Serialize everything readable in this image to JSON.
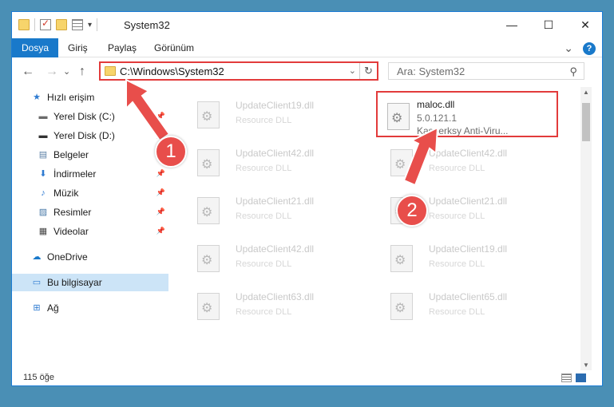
{
  "window": {
    "title": "System32",
    "controls": {
      "minimize": "—",
      "maximize": "☐",
      "close": "✕"
    }
  },
  "ribbon": {
    "tabs": [
      "Dosya",
      "Giriş",
      "Paylaş",
      "Görünüm"
    ],
    "active_tab": "Dosya",
    "expand_glyph": "⌄",
    "help_glyph": "?"
  },
  "navigation": {
    "back": "←",
    "forward": "→",
    "history": "⌄",
    "up": "↑"
  },
  "address": {
    "path": "C:\\Windows\\System32",
    "dropdown_glyph": "⌄",
    "refresh_glyph": "↻"
  },
  "search": {
    "placeholder": "Ara: System32",
    "icon_glyph": "⚲"
  },
  "sidebar": {
    "items": [
      {
        "label": "Hızlı erişim",
        "icon": "star-icon",
        "glyph": "★",
        "color": "#2f7bd1",
        "pinned": false
      },
      {
        "label": "Yerel Disk (C:)",
        "icon": "drive-icon",
        "glyph": "▬",
        "color": "#6b6b6b",
        "pinned": true
      },
      {
        "label": "Yerel Disk (D:)",
        "icon": "drive-icon",
        "glyph": "▬",
        "color": "#333333",
        "pinned": true
      },
      {
        "label": "Belgeler",
        "icon": "documents-icon",
        "glyph": "▤",
        "color": "#5b7fa6",
        "pinned": true
      },
      {
        "label": "İndirmeler",
        "icon": "download-icon",
        "glyph": "⬇",
        "color": "#2f7bd1",
        "pinned": true
      },
      {
        "label": "Müzik",
        "icon": "music-icon",
        "glyph": "♪",
        "color": "#2f7bd1",
        "pinned": true
      },
      {
        "label": "Resimler",
        "icon": "pictures-icon",
        "glyph": "▨",
        "color": "#4a7aa8",
        "pinned": true
      },
      {
        "label": "Videolar",
        "icon": "videos-icon",
        "glyph": "▦",
        "color": "#444444",
        "pinned": true
      },
      {
        "label": "OneDrive",
        "icon": "cloud-icon",
        "glyph": "☁",
        "color": "#1979ca",
        "pinned": false
      },
      {
        "label": "Bu bilgisayar",
        "icon": "computer-icon",
        "glyph": "▭",
        "color": "#2f7bd1",
        "pinned": false,
        "selected": true
      },
      {
        "label": "Ağ",
        "icon": "network-icon",
        "glyph": "⊞",
        "color": "#2f7bd1",
        "pinned": false
      }
    ],
    "pin_glyph": "📌"
  },
  "files": [
    {
      "name": "UpdateClient19.dll",
      "type": "Resource DLL"
    },
    {
      "name": "UpdateClient42.dll",
      "type": "Resource DLL"
    },
    {
      "name": "UpdateClient21.dll",
      "type": "Resource DLL"
    },
    {
      "name": "UpdateClient42.dll",
      "type": "Resource DLL"
    },
    {
      "name": "UpdateClient63.dll",
      "type": "Resource DLL"
    },
    {
      "name": "maloc.dll",
      "version": "5.0.121.1",
      "description": "Kasperksy Anti-Viru...",
      "highlighted": true
    },
    {
      "name": "UpdateClient42.dll",
      "type": "Resource DLL"
    },
    {
      "name": "UpdateClient21.dll",
      "type": "Resource DLL"
    },
    {
      "name": "UpdateClient19.dll",
      "type": "Resource DLL"
    },
    {
      "name": "UpdateClient65.dll",
      "type": "Resource DLL"
    }
  ],
  "status": {
    "item_count": "115 öğe"
  },
  "annotations": {
    "badge1": "1",
    "badge2": "2",
    "color": "#e84e4b"
  }
}
